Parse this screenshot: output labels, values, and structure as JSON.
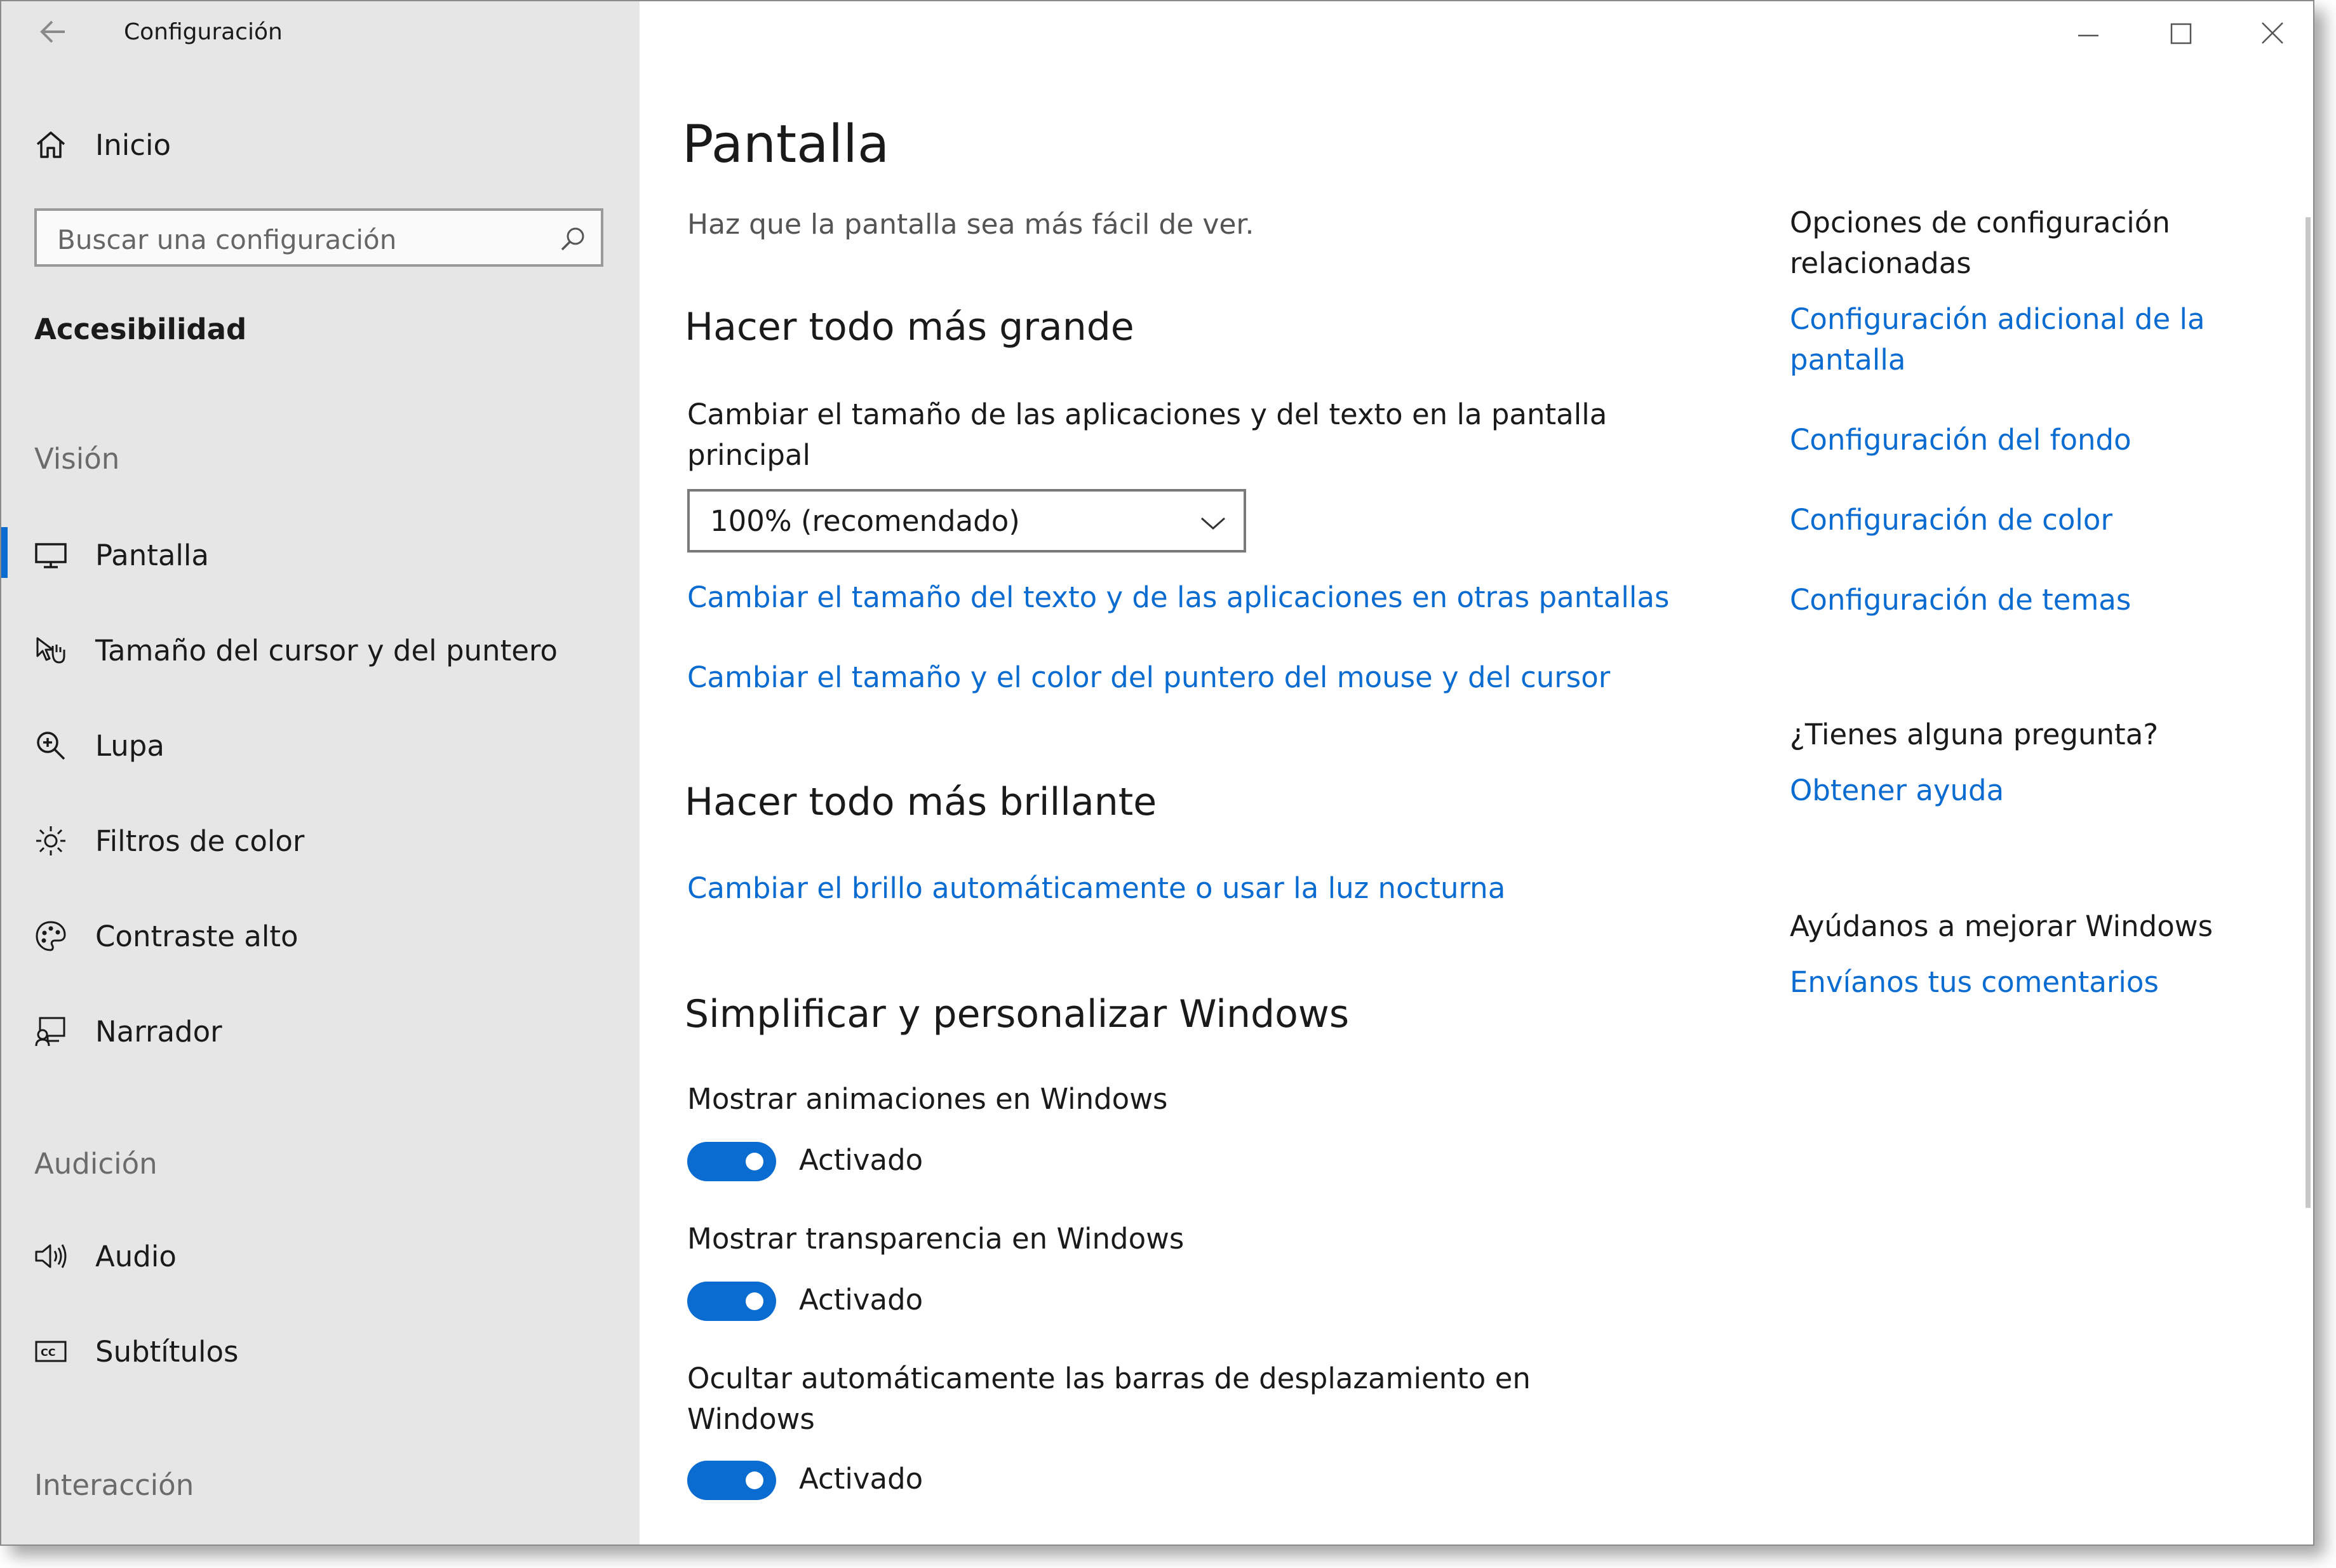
{
  "app": {
    "title": "Configuración"
  },
  "sidebar": {
    "home_label": "Inicio",
    "search_placeholder": "Buscar una configuración",
    "category": "Accesibilidad",
    "sections": {
      "vision": "Visión",
      "audicion": "Audición",
      "interaccion": "Interacción"
    },
    "items": [
      {
        "label": "Pantalla",
        "icon": "monitor-icon",
        "active": true
      },
      {
        "label": "Tamaño del cursor y del puntero",
        "icon": "pointer-icon",
        "active": false
      },
      {
        "label": "Lupa",
        "icon": "magnifier-icon",
        "active": false
      },
      {
        "label": "Filtros de color",
        "icon": "sun-icon",
        "active": false
      },
      {
        "label": "Contraste alto",
        "icon": "palette-icon",
        "active": false
      },
      {
        "label": "Narrador",
        "icon": "narrator-icon",
        "active": false
      },
      {
        "label": "Audio",
        "icon": "speaker-icon",
        "active": false
      },
      {
        "label": "Subtítulos",
        "icon": "captions-icon",
        "active": false
      }
    ]
  },
  "main": {
    "title": "Pantalla",
    "subtitle": "Haz que la pantalla sea más fácil de ver.",
    "section1": {
      "heading": "Hacer todo más grande",
      "description_line1": "Cambiar el tamaño de las aplicaciones y del texto en la pantalla",
      "description_line2": "principal",
      "dropdown_value": "100% (recomendado)",
      "link1": "Cambiar el tamaño del texto y de las aplicaciones en otras pantallas",
      "link2": "Cambiar el tamaño y el color del puntero del mouse y del cursor"
    },
    "section2": {
      "heading": "Hacer todo más brillante",
      "link": "Cambiar el brillo automáticamente o usar la luz nocturna"
    },
    "section3": {
      "heading": "Simplificar y personalizar Windows",
      "toggles": [
        {
          "label_line1": "Mostrar animaciones en Windows",
          "label_line2": "",
          "state": "Activado",
          "on": true
        },
        {
          "label_line1": "Mostrar transparencia en Windows",
          "label_line2": "",
          "state": "Activado",
          "on": true
        },
        {
          "label_line1": "Ocultar automáticamente las barras de desplazamiento en",
          "label_line2": "Windows",
          "state": "Activado",
          "on": true
        }
      ]
    }
  },
  "related": {
    "heading_line1": "Opciones de configuración",
    "heading_line2": "relacionadas",
    "links": {
      "additional_line1": "Configuración adicional de la",
      "additional_line2": "pantalla",
      "background": "Configuración del fondo",
      "color": "Configuración de color",
      "themes": "Configuración de temas"
    },
    "question": "¿Tienes alguna pregunta?",
    "help_link": "Obtener ayuda",
    "improve": "Ayúdanos a mejorar Windows",
    "feedback_link": "Envíanos tus comentarios"
  },
  "colors": {
    "accent": "#0a6cd1",
    "sidebar_bg": "#e6e6e6"
  }
}
